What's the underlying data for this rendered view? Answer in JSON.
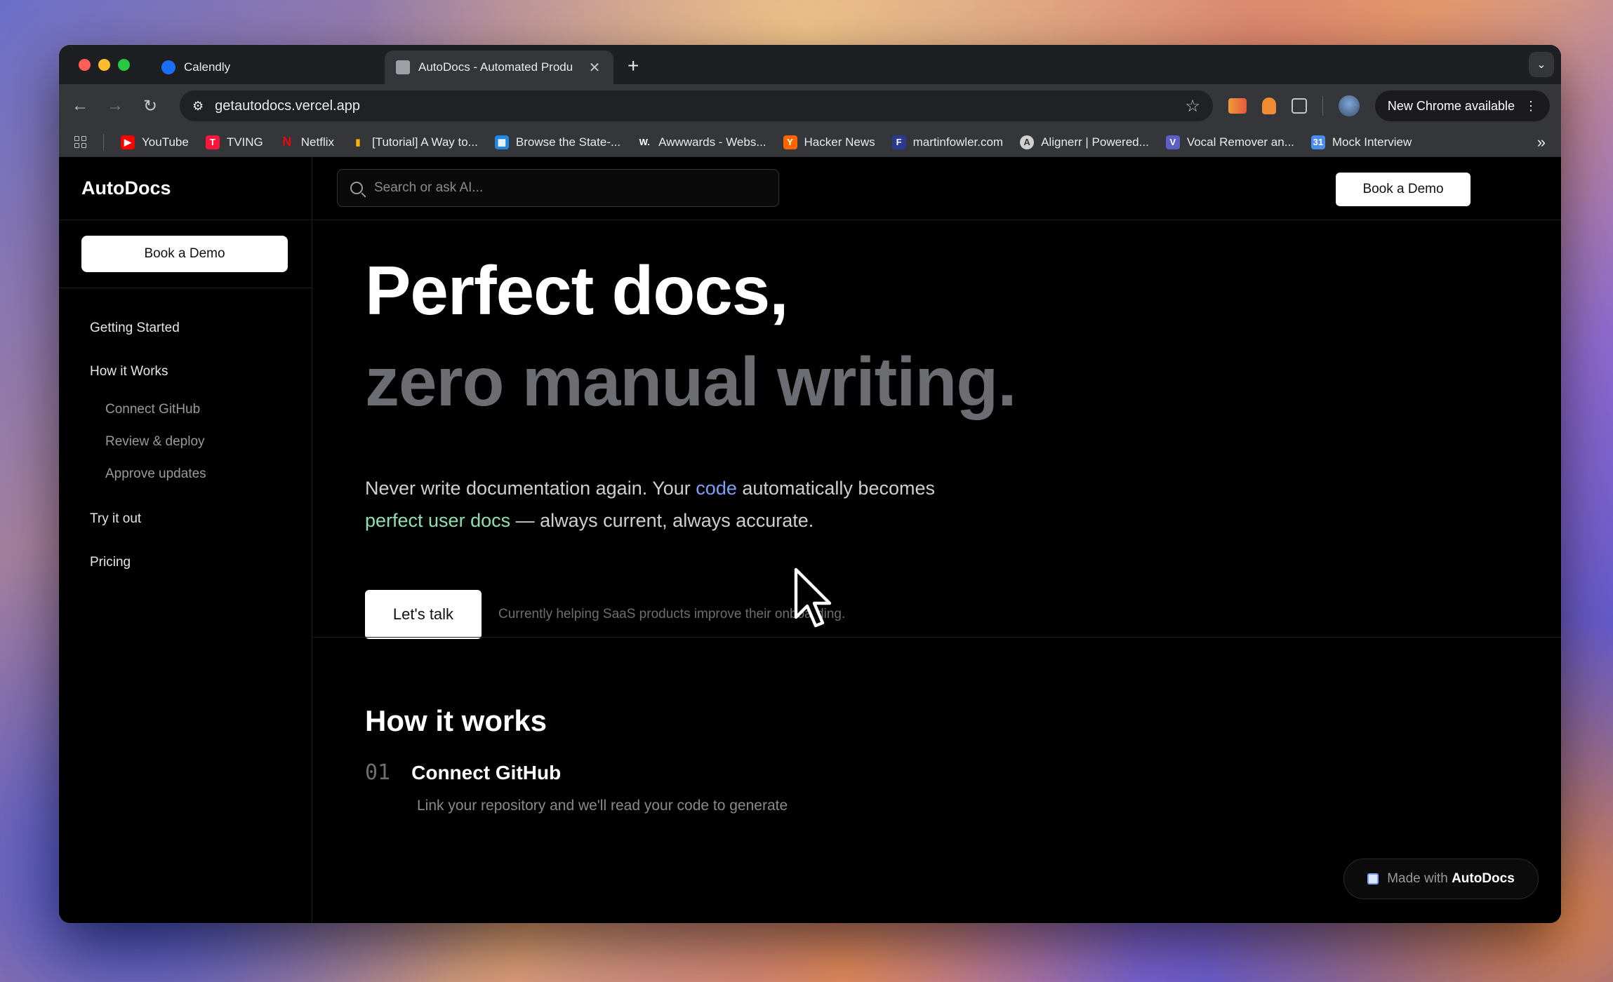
{
  "browser": {
    "tabs": [
      {
        "title": "Calendly",
        "active": false,
        "favicon_color": "#1a6ef5"
      },
      {
        "title": "AutoDocs - Automated Produ",
        "active": true,
        "favicon_color": "#9aa0a6"
      }
    ],
    "new_tab_label": "+",
    "url": "getautodocs.vercel.app",
    "update_button_label": "New Chrome available",
    "bookmarks": [
      {
        "label": "YouTube",
        "icon": "youtube-icon",
        "color": "#ff0000"
      },
      {
        "label": "TVING",
        "icon": "tving-icon",
        "color": "#ff153c"
      },
      {
        "label": "Netflix",
        "icon": "netflix-icon",
        "color": "#e50914"
      },
      {
        "label": "[Tutorial] A Way to...",
        "icon": "chart-icon",
        "color": "#f5b400"
      },
      {
        "label": "Browse the State-...",
        "icon": "papers-icon",
        "color": "#1e88e5"
      },
      {
        "label": "Awwwards - Webs...",
        "icon": "awwwards-icon",
        "color": "#222222"
      },
      {
        "label": "Hacker News",
        "icon": "hackernews-icon",
        "color": "#ff6600"
      },
      {
        "label": "martinfowler.com",
        "icon": "martinfowler-icon",
        "color": "#2b3a8f"
      },
      {
        "label": "Alignerr | Powered...",
        "icon": "alignerr-icon",
        "color": "#9a9a9a"
      },
      {
        "label": "Vocal Remover an...",
        "icon": "vocal-remover-icon",
        "color": "#5b5fc7"
      },
      {
        "label": "Mock Interview",
        "icon": "mock-interview-icon",
        "color": "#4a8cf0"
      }
    ]
  },
  "site": {
    "brand": "AutoDocs",
    "sidebar_cta": "Book a Demo",
    "nav": [
      {
        "label": "Getting Started",
        "level": 1
      },
      {
        "label": "How it Works",
        "level": 1
      },
      {
        "label": "Connect GitHub",
        "level": 2
      },
      {
        "label": "Review & deploy",
        "level": 2
      },
      {
        "label": "Approve updates",
        "level": 2
      },
      {
        "label": "Try it out",
        "level": 1
      },
      {
        "label": "Pricing",
        "level": 1
      }
    ],
    "search_placeholder": "Search or ask AI...",
    "top_cta": "Book a Demo",
    "hero": {
      "line1": "Perfect docs,",
      "line2": "zero manual writing.",
      "lead_part1": "Never write documentation again. Your ",
      "lead_code": "code",
      "lead_part2": " automatically becomes",
      "lead_green": "perfect user docs",
      "lead_part3": " — always current, always accurate.",
      "cta": "Let's talk",
      "helper": "Currently helping SaaS products improve their onboarding."
    },
    "how_it_works": {
      "title": "How it works",
      "steps": [
        {
          "num": "01",
          "title": "Connect GitHub",
          "desc": "Link your repository and we'll read your code to generate"
        }
      ]
    },
    "made_with_prefix": "Made with ",
    "made_with_brand": "AutoDocs"
  }
}
